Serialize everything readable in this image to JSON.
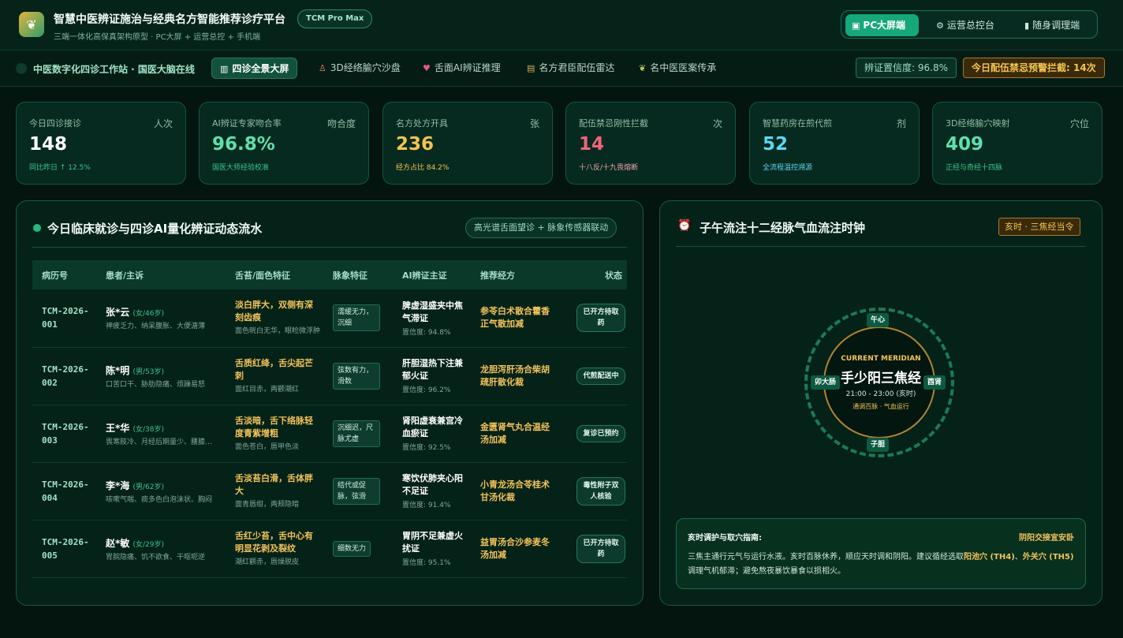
{
  "header": {
    "title": "智慧中医辨证施治与经典名方智能推荐诊疗平台",
    "badge": "TCM Pro Max",
    "subtitle": "三端一体化高保真架构原型 · PC大屏 + 运营总控 + 手机端",
    "modes": [
      {
        "label": "PC大屏端",
        "icon": "monitor-icon",
        "active": true
      },
      {
        "label": "运营总控台",
        "icon": "gear-icon",
        "active": false
      },
      {
        "label": "随身调理端",
        "icon": "phone-icon",
        "active": false
      }
    ]
  },
  "nav": {
    "brand": "中医数字化四诊工作站 · 国医大脑在线",
    "tabs": [
      {
        "label": "四诊全景大屏",
        "icon": "chart-icon",
        "active": true
      },
      {
        "label": "3D经络腧穴沙盘",
        "icon": "figure-icon",
        "active": false
      },
      {
        "label": "舌面AI辨证推理",
        "icon": "tongue-icon",
        "active": false
      },
      {
        "label": "名方君臣配伍雷达",
        "icon": "scroll-icon",
        "active": false
      },
      {
        "label": "名中医医案传承",
        "icon": "herb-icon",
        "active": false
      }
    ],
    "confidence": "辨证置信度: 96.8%",
    "warning": "今日配伍禁忌预警拦截: 14次"
  },
  "stats": [
    {
      "label": "今日四诊接诊",
      "unit": "人次",
      "value": "148",
      "sub": "同比昨日 ↑ 12.5%",
      "color": "#ffffff",
      "sub_color": "#3cc48f"
    },
    {
      "label": "AI辨证专家吻合率",
      "unit": "吻合度",
      "value": "96.8%",
      "sub": "国医大师经验校准",
      "color": "#5fe0b0",
      "sub_color": "#3cc48f"
    },
    {
      "label": "名方处方开具",
      "unit": "张",
      "value": "236",
      "sub": "经方占比 84.2%",
      "color": "#f4c44f",
      "sub_color": "#f4c44f"
    },
    {
      "label": "配伍禁忌刚性拦截",
      "unit": "次",
      "value": "14",
      "sub": "十八反/十九畏熔断",
      "color": "#f0657a",
      "sub_color": "#f0a2ae"
    },
    {
      "label": "智慧药房在煎代煎",
      "unit": "剂",
      "value": "52",
      "sub": "全流程温控溯源",
      "color": "#5fd6f0",
      "sub_color": "#5fd6f0"
    },
    {
      "label": "3D经络腧穴映射",
      "unit": "穴位",
      "value": "409",
      "sub": "正经与奇经十四脉",
      "color": "#5fe0b0",
      "sub_color": "#3cc48f"
    }
  ],
  "clinic": {
    "title": "今日临床就诊与四诊AI量化辨证动态流水",
    "link": "高光谱舌面望诊 + 脉象传感器联动",
    "columns": [
      "病历号",
      "患者/主诉",
      "舌苔/面色特征",
      "脉象特征",
      "AI辨证主证",
      "推荐经方",
      "状态"
    ],
    "rows": [
      {
        "id": "TCM-2026-001",
        "name": "张*云",
        "meta": "(女/46岁)",
        "symptom": "神疲乏力、纳呆腹胀、大便溏薄",
        "tongue": "淡白胖大，双侧有深刻齿痕",
        "face": "面色晄白无华，眼睑微浮肿",
        "pulse": "濡缓无力，沉细",
        "syndrome": "脾虚湿盛夹中焦气滞证",
        "conf": "置信度: 94.8%",
        "rx": "参苓白术散合藿香正气散加减",
        "status": "已开方待取药"
      },
      {
        "id": "TCM-2026-002",
        "name": "陈*明",
        "meta": "(男/53岁)",
        "symptom": "口苦口干、胁肋隐痛、烦躁易怒",
        "tongue": "舌质红绛，舌尖起芒刺",
        "face": "面红目赤，两颧潮红",
        "pulse": "弦数有力，滑数",
        "syndrome": "肝胆湿热下注兼郁火证",
        "conf": "置信度: 96.2%",
        "rx": "龙胆泻肝汤合柴胡疏肝散化裁",
        "status": "代煎配送中"
      },
      {
        "id": "TCM-2026-003",
        "name": "王*华",
        "meta": "(女/38岁)",
        "symptom": "畏寒肢冷、月经后期量少、腰膝酸软",
        "tongue": "舌淡暗，舌下络脉轻度青紫增粗",
        "face": "面色苍白，唇甲色淡",
        "pulse": "沉细迟，尺脉尤虚",
        "syndrome": "肾阳虚衰兼宫冷血瘀证",
        "conf": "置信度: 92.5%",
        "rx": "金匮肾气丸合温经汤加减",
        "status": "复诊已预约"
      },
      {
        "id": "TCM-2026-004",
        "name": "李*海",
        "meta": "(男/62岁)",
        "symptom": "咳嗽气喘、痰多色白泡沫状、胸闷",
        "tongue": "舌淡苔白滑，舌体胖大",
        "face": "面青唇绀，两颊隐暗",
        "pulse": "结代或促脉，弦滑",
        "syndrome": "寒饮伏肺夹心阳不足证",
        "conf": "置信度: 91.4%",
        "rx": "小青龙汤合苓桂术甘汤化裁",
        "status": "毒性附子双人核验"
      },
      {
        "id": "TCM-2026-005",
        "name": "赵*敏",
        "meta": "(女/29岁)",
        "symptom": "胃脘隐痛、饥不欲食、干呕呃逆",
        "tongue": "舌红少苔，舌中心有明显花剥及裂纹",
        "face": "潮红颧赤，唇燥脱皮",
        "pulse": "细数无力",
        "syndrome": "胃阴不足兼虚火扰证",
        "conf": "置信度: 95.1%",
        "rx": "益胃汤合沙参麦冬汤加减",
        "status": "已开方待取药"
      }
    ]
  },
  "meridian": {
    "title": "子午流注十二经脉气血流注时钟",
    "hour_badge": "亥时 · 三焦经当令",
    "current_en": "CURRENT MERIDIAN",
    "current_name": "手少阳三焦经",
    "current_time": "21:00 - 23:00 (亥时)",
    "current_note": "通调百脉 · 气血运行",
    "hours": {
      "top": "午心",
      "left": "卯大肠",
      "right": "酉肾",
      "bottom": "子胆"
    },
    "guide_title": "亥时调护与取穴指南:",
    "guide_tag": "阴阳交接宜安卧",
    "guide_text_1": "三焦主通行元气与运行水液。亥时百脉休养，顺应天时调和阴阳。建议循经选取",
    "guide_point_1": "阳池穴 (TH4)",
    "guide_sep": "、",
    "guide_point_2": "外关穴 (TH5)",
    "guide_text_2": "调理气机郁滞；避免熬夜暴饮暴食以损相火。"
  }
}
